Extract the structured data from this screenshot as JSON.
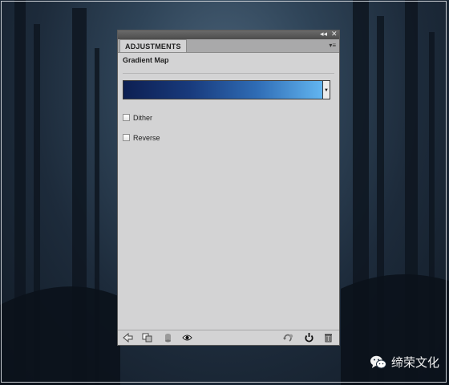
{
  "panel": {
    "tab_label": "ADJUSTMENTS",
    "title": "Gradient Map",
    "titlebar_controls": {
      "collapse": "◂◂",
      "close": "✕"
    },
    "panel_menu_icon": "panel-menu-icon",
    "gradient": {
      "colors": [
        "#0d1f52",
        "#183a7c",
        "#2f6cb5",
        "#62b5f0"
      ],
      "dropdown_icon": "dropdown-arrow-icon"
    },
    "options": [
      {
        "label": "Dither",
        "checked": false
      },
      {
        "label": "Reverse",
        "checked": false
      }
    ],
    "toolbar": {
      "left_icons": [
        "back-arrow-icon",
        "clip-to-layer-icon",
        "layer-mask-icon",
        "eye-visibility-icon"
      ],
      "right_icons": [
        "previous-state-icon",
        "reset-icon",
        "trash-icon"
      ]
    }
  },
  "watermark": {
    "text": "缔荣文化",
    "icon": "wechat-logo-icon"
  },
  "background": {
    "description_icon": "forest-background"
  }
}
